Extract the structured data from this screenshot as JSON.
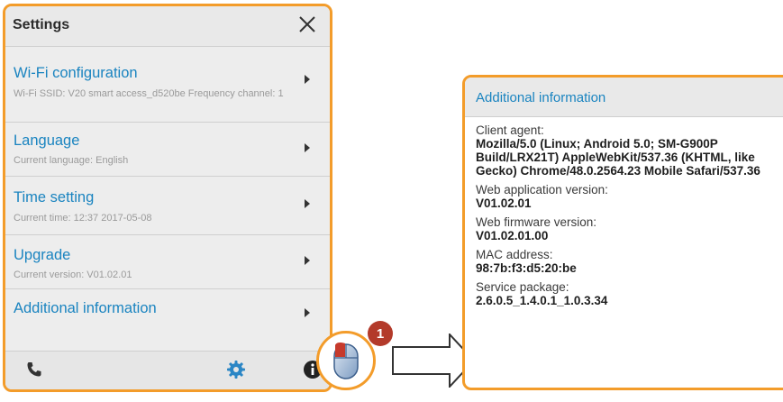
{
  "settings": {
    "title": "Settings",
    "items": [
      {
        "label": "Wi-Fi configuration",
        "sub": "Wi-Fi SSID: V20 smart access_d520be   Frequency channel: 1"
      },
      {
        "label": "Language",
        "sub": "Current language: English"
      },
      {
        "label": "Time setting",
        "sub": "Current time: 12:37 2017-05-08"
      },
      {
        "label": "Upgrade",
        "sub": "Current version: V01.02.01"
      },
      {
        "label": "Additional information",
        "sub": ""
      }
    ],
    "toolbar": [
      "phone-icon",
      "gear-icon",
      "info-icon"
    ]
  },
  "step_badge": "1",
  "info": {
    "title": "Additional information",
    "client_agent_label": "Client agent:",
    "client_agent_value": "Mozilla/5.0 (Linux; Android 5.0; SM-G900P Build/LRX21T) AppleWebKit/537.36 (KHTML, like Gecko) Chrome/48.0.2564.23 Mobile Safari/537.36",
    "web_app_version_label": "Web application version:",
    "web_app_version_value": "V01.02.01",
    "web_fw_version_label": "Web firmware version:",
    "web_fw_version_value": "V01.02.01.00",
    "mac_label": "MAC address:",
    "mac_value": "98:7b:f3:d5:20:be",
    "service_pkg_label": "Service package:",
    "service_pkg_value": "2.6.0.5_1.4.0.1_1.0.3.34"
  },
  "colors": {
    "accent": "#f39c2a",
    "link": "#1a84c0",
    "badge": "#b33a2a",
    "gear": "#2b86c5"
  }
}
